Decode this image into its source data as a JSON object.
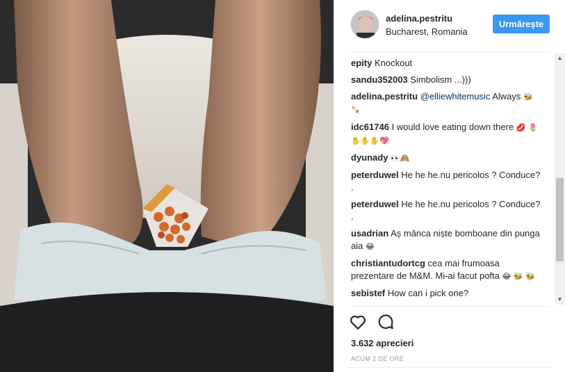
{
  "post": {
    "username": "adelina.pestritu",
    "location": "Bucharest, Romania",
    "follow_label": "Urmărește",
    "likes": "3.632 aprecieri",
    "time": "ACUM 2 DE ORE"
  },
  "comments": [
    {
      "user": "epity",
      "text": "Knockout",
      "emoji": ""
    },
    {
      "user": "sandu352003",
      "text": "Simbolism ...)))",
      "emoji": ""
    },
    {
      "user": "adelina.pestritu",
      "mention": "@elliewhitemusic",
      "text": "Always",
      "emoji": "🐝 🍡"
    },
    {
      "user": "idc61746",
      "text": "I would love eating down there",
      "emoji": "💋 🌷✋✋✋💖"
    },
    {
      "user": "dyunady",
      "text": "",
      "emoji": "👀🙈"
    },
    {
      "user": "peterduwel",
      "text": "He he he.nu pericolos ? Conduce? .",
      "emoji": ""
    },
    {
      "user": "peterduwel",
      "text": "He he he.nu pericolos ? Conduce? .",
      "emoji": ""
    },
    {
      "user": "usadrian",
      "text": "Aș mânca niște bomboane din punga aia",
      "emoji": "😂"
    },
    {
      "user": "christiantudortcg",
      "text": "cea mai frumoasa prezentare de M&M. Mi-ai facut pofta",
      "emoji": "😂 🐝 🐝"
    },
    {
      "user": "sebistef",
      "text": "How can i pick one?",
      "emoji": ""
    }
  ],
  "icons": {
    "heart": "heart-icon",
    "comment": "comment-icon",
    "scroll_up": "▲",
    "scroll_down": "▼"
  },
  "colors": {
    "accent": "#3897f0",
    "text": "#262626",
    "muted": "#999999"
  }
}
